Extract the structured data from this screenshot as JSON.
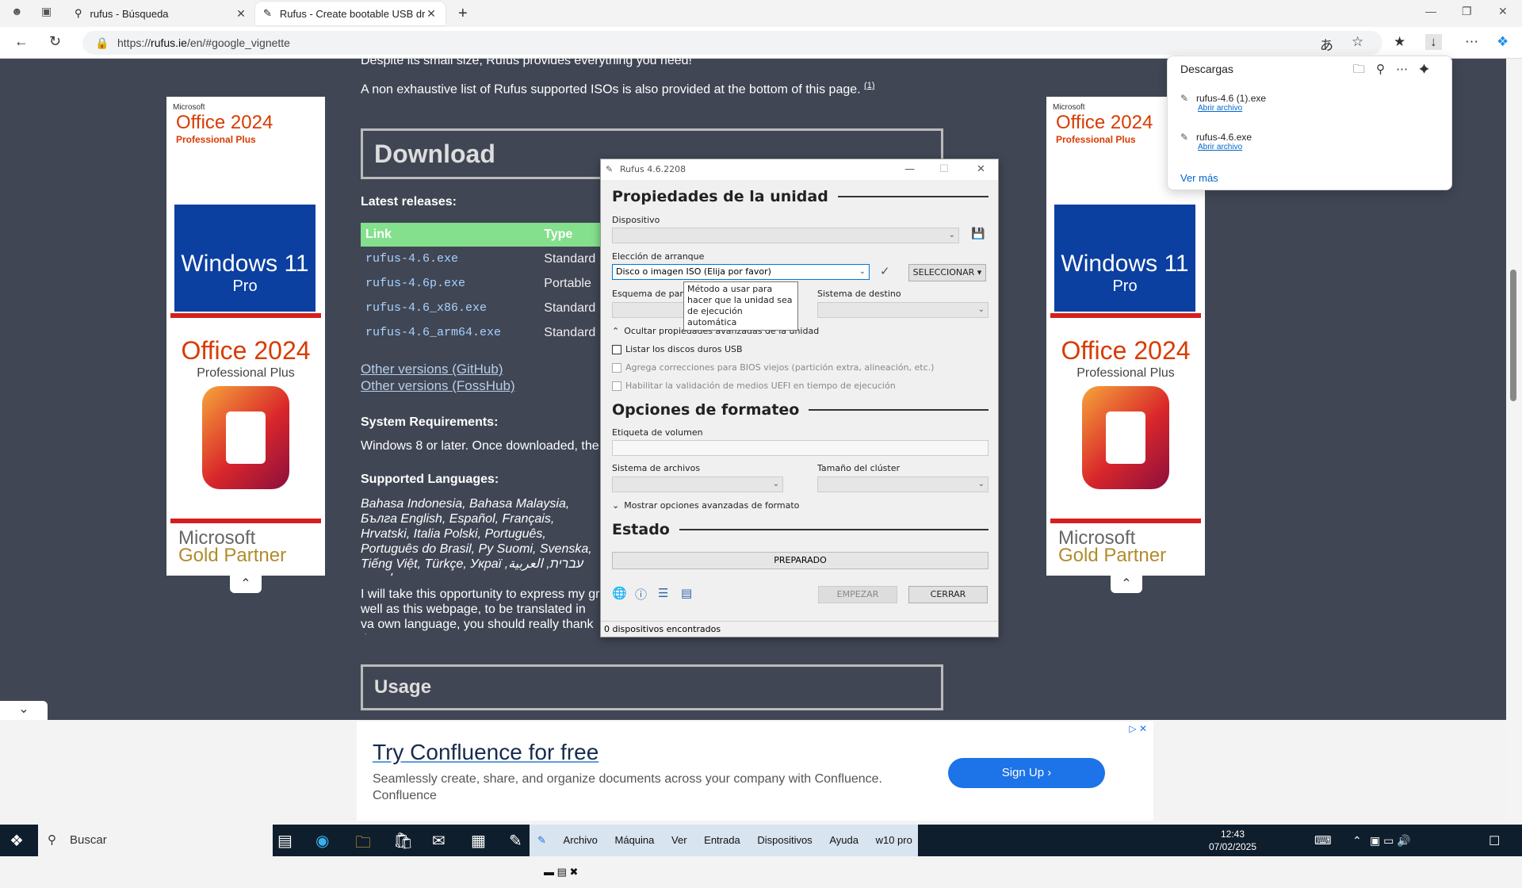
{
  "browser": {
    "tabs": [
      {
        "title": "rufus - Búsqueda"
      },
      {
        "title": "Rufus - Create bootable USB drive"
      }
    ],
    "url_prefix": "https://",
    "url_domain": "rufus.ie",
    "url_path": "/en/#google_vignette"
  },
  "page": {
    "line1": "Despite its small size, Rufus provides everything you need!",
    "line2": "A non exhaustive list of Rufus supported ISOs is also provided at the bottom of this page.",
    "line2_note": "(1)",
    "download_heading": "Download",
    "latest_releases": "Latest releases:",
    "table": {
      "headers": [
        "Link",
        "Type"
      ],
      "rows": [
        [
          "rufus-4.6.exe",
          "Standard"
        ],
        [
          "rufus-4.6p.exe",
          "Portable"
        ],
        [
          "rufus-4.6_x86.exe",
          "Standard"
        ],
        [
          "rufus-4.6_arm64.exe",
          "Standard"
        ]
      ]
    },
    "other_github": "Other versions (GitHub)",
    "other_fosshub": "Other versions (FossHub)",
    "sysreq_heading": "System Requirements:",
    "sysreq_text": "Windows 8 or later. Once downloaded, the",
    "languages_heading": "Supported Languages:",
    "languages_text": "Bahasa Indonesia, Bahasa Malaysia, Бълга English, Español, Français, Hrvatski, Italia Polski, Português, Português do Brasil, Ру Suomi, Svenska, Tiếng Việt, Türkçe, Украї עברית, العربية, پارسی.",
    "thanks_text": "I will take this opportunity to express my gr well as this webpage, to be translated in va own language, you should really thank the",
    "usage_heading": "Usage"
  },
  "ads": {
    "left": {
      "ms": "Microsoft",
      "office": "Office 2024",
      "pro_plus": "Professional Plus",
      "win": "Windows 11",
      "pro": "Pro",
      "gold1": "Microsoft",
      "gold2": "Gold Partner"
    },
    "right": {
      "ms": "Microsoft",
      "office": "Office 2024",
      "pro_plus": "Professional Plus",
      "win": "Windows 11",
      "pro": "Pro",
      "gold1": "Microsoft",
      "gold2": "Gold Partner"
    }
  },
  "confluence_ad": {
    "title": "Try Confluence for free",
    "desc": "Seamlessly create, share, and organize documents across your company with Confluence.",
    "brand": "Confluence",
    "cta": "Sign Up"
  },
  "downloads": {
    "title": "Descargas",
    "items": [
      {
        "name": "rufus-4.6 (1).exe",
        "action": "Abrir archivo"
      },
      {
        "name": "rufus-4.6.exe",
        "action": "Abrir archivo"
      }
    ],
    "more": "Ver más"
  },
  "rufus": {
    "title": "Rufus 4.6.2208",
    "drive_props": "Propiedades de la unidad",
    "device_label": "Dispositivo",
    "device_value": "",
    "boot_label": "Elección de arranque",
    "boot_value": "Disco o imagen ISO (Elija por favor)",
    "select_button": "SELECCIONAR",
    "partition_label": "Esquema de part",
    "target_label": "Sistema de destino",
    "tooltip": "Método a usar para hacer que la unidad sea de ejecución automática",
    "hide_advanced": "Ocultar propiedades avanzadas de la unidad",
    "list_usb": "Listar los discos duros USB",
    "bios_fix": "Agrega correcciones para BIOS viejos (partición extra, alineación, etc.)",
    "uefi_check": "Habilitar la validación de medios UEFI en tiempo de ejecución",
    "format_options": "Opciones de formateo",
    "volume_label": "Etiqueta de volumen",
    "fs_label": "Sistema de archivos",
    "cluster_label": "Tamaño del clúster",
    "show_advanced_format": "Mostrar opciones avanzadas de formato",
    "status_heading": "Estado",
    "status_value": "PREPARADO",
    "start_button": "EMPEZAR",
    "close_button": "CERRAR",
    "footer": "0 dispositivos encontrados"
  },
  "taskbar": {
    "search": "Buscar",
    "vb_menu": [
      "Archivo",
      "Máquina",
      "Ver",
      "Entrada",
      "Dispositivos",
      "Ayuda"
    ],
    "vm_name": "w10 pro",
    "time": "12:43",
    "date": "07/02/2025"
  }
}
